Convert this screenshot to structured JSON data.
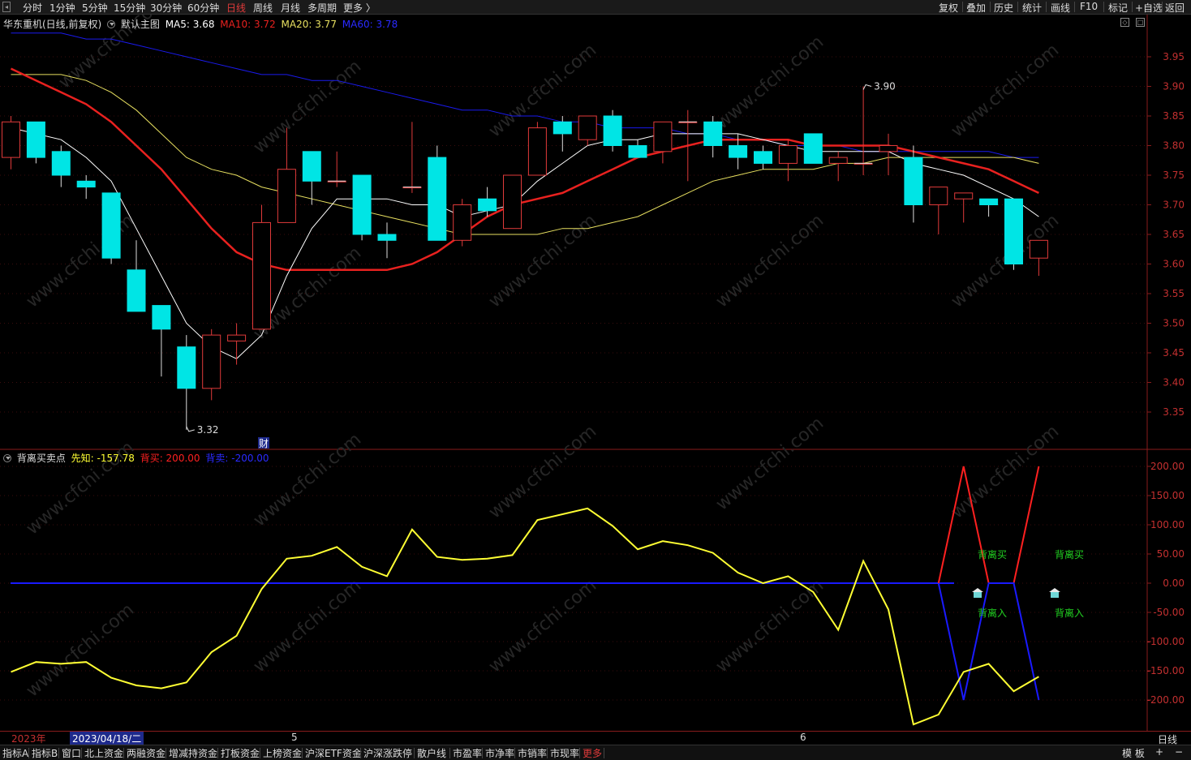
{
  "toolbar": {
    "periods": [
      "分时",
      "1分钟",
      "5分钟",
      "15分钟",
      "30分钟",
      "60分钟",
      "日线",
      "周线",
      "月线",
      "多周期",
      "更多 〉"
    ],
    "active_period": "日线",
    "right_buttons": [
      "复权",
      "叠加",
      "历史",
      "统计",
      "画线",
      "F10",
      "标记",
      "+自选",
      "返回"
    ]
  },
  "main_legend": {
    "stock": "华东重机(日线,前复权)",
    "template": "默认主图",
    "ma5": "MA5: 3.68",
    "ma10": "MA10: 3.72",
    "ma20": "MA20: 3.77",
    "ma60": "MA60: 3.78"
  },
  "sub_legend": {
    "name": "背离买卖点",
    "xianzhi": "先知: -157.78",
    "beimai": "背买: 200.00",
    "beimai_sell": "背卖: -200.00"
  },
  "annotations": {
    "high": "3.90",
    "low": "3.32",
    "finance_badge": "财",
    "buy1": "背离买",
    "buy2": "背离买",
    "in1": "背离入",
    "in2": "背离入"
  },
  "date_axis": {
    "year": "2023年",
    "selected_date": "2023/04/18/二",
    "month5": "5",
    "month6": "6",
    "period_label": "日线"
  },
  "bottom_tabs": [
    "指标A",
    "指标B",
    "窗口",
    "北上资金",
    "两融资金",
    "增减持资金",
    "打板资金",
    "上榜资金",
    "沪深ETF资金",
    "沪深涨跌停",
    "散户线",
    "市盈率",
    "市净率",
    "市销率",
    "市现率",
    "更多"
  ],
  "bottom_right": [
    "模 板",
    "+",
    "−"
  ],
  "watermark": "www.cfchi.com",
  "colors": {
    "up": "#e03a3a",
    "down": "#00e5e5",
    "ma5": "#ffffff",
    "ma10": "#e8211f",
    "ma20": "#e8e060",
    "ma60": "#1a1aee",
    "xianzhi": "#ffff33",
    "beimai": "#ff2020",
    "beimai_sell": "#1a1aff",
    "signal_text": "#21d021"
  },
  "chart_data": [
    {
      "type": "candlestick",
      "title": "华东重机(日线,前复权)",
      "ylim": [
        3.29,
        3.99
      ],
      "yticks": [
        "3.95",
        "3.90",
        "3.85",
        "3.80",
        "3.75",
        "3.70",
        "3.65",
        "3.60",
        "3.55",
        "3.50",
        "3.45",
        "3.40",
        "3.35"
      ],
      "candles": [
        {
          "o": 3.78,
          "h": 3.85,
          "l": 3.76,
          "c": 3.84
        },
        {
          "o": 3.84,
          "h": 3.84,
          "l": 3.77,
          "c": 3.78
        },
        {
          "o": 3.79,
          "h": 3.8,
          "l": 3.73,
          "c": 3.75
        },
        {
          "o": 3.74,
          "h": 3.75,
          "l": 3.71,
          "c": 3.73
        },
        {
          "o": 3.72,
          "h": 3.72,
          "l": 3.6,
          "c": 3.61
        },
        {
          "o": 3.59,
          "h": 3.64,
          "l": 3.52,
          "c": 3.52
        },
        {
          "o": 3.53,
          "h": 3.53,
          "l": 3.41,
          "c": 3.49
        },
        {
          "o": 3.46,
          "h": 3.48,
          "l": 3.32,
          "c": 3.39
        },
        {
          "o": 3.39,
          "h": 3.49,
          "l": 3.37,
          "c": 3.48
        },
        {
          "o": 3.47,
          "h": 3.5,
          "l": 3.43,
          "c": 3.48
        },
        {
          "o": 3.49,
          "h": 3.7,
          "l": 3.49,
          "c": 3.67
        },
        {
          "o": 3.67,
          "h": 3.83,
          "l": 3.67,
          "c": 3.76
        },
        {
          "o": 3.79,
          "h": 3.79,
          "l": 3.7,
          "c": 3.74
        },
        {
          "o": 3.74,
          "h": 3.79,
          "l": 3.73,
          "c": 3.74
        },
        {
          "o": 3.75,
          "h": 3.75,
          "l": 3.64,
          "c": 3.65
        },
        {
          "o": 3.65,
          "h": 3.67,
          "l": 3.61,
          "c": 3.64
        },
        {
          "o": 3.73,
          "h": 3.84,
          "l": 3.72,
          "c": 3.73
        },
        {
          "o": 3.78,
          "h": 3.8,
          "l": 3.64,
          "c": 3.64
        },
        {
          "o": 3.64,
          "h": 3.71,
          "l": 3.63,
          "c": 3.7
        },
        {
          "o": 3.71,
          "h": 3.73,
          "l": 3.68,
          "c": 3.69
        },
        {
          "o": 3.66,
          "h": 3.75,
          "l": 3.66,
          "c": 3.75
        },
        {
          "o": 3.75,
          "h": 3.84,
          "l": 3.75,
          "c": 3.83
        },
        {
          "o": 3.84,
          "h": 3.85,
          "l": 3.79,
          "c": 3.82
        },
        {
          "o": 3.81,
          "h": 3.85,
          "l": 3.8,
          "c": 3.85
        },
        {
          "o": 3.85,
          "h": 3.86,
          "l": 3.79,
          "c": 3.8
        },
        {
          "o": 3.8,
          "h": 3.81,
          "l": 3.78,
          "c": 3.78
        },
        {
          "o": 3.79,
          "h": 3.84,
          "l": 3.77,
          "c": 3.84
        },
        {
          "o": 3.84,
          "h": 3.86,
          "l": 3.74,
          "c": 3.84
        },
        {
          "o": 3.84,
          "h": 3.85,
          "l": 3.78,
          "c": 3.8
        },
        {
          "o": 3.8,
          "h": 3.82,
          "l": 3.76,
          "c": 3.78
        },
        {
          "o": 3.79,
          "h": 3.8,
          "l": 3.76,
          "c": 3.77
        },
        {
          "o": 3.77,
          "h": 3.81,
          "l": 3.74,
          "c": 3.8
        },
        {
          "o": 3.82,
          "h": 3.82,
          "l": 3.77,
          "c": 3.77
        },
        {
          "o": 3.77,
          "h": 3.79,
          "l": 3.74,
          "c": 3.78
        },
        {
          "o": 3.77,
          "h": 3.9,
          "l": 3.75,
          "c": 3.77
        },
        {
          "o": 3.79,
          "h": 3.82,
          "l": 3.75,
          "c": 3.8
        },
        {
          "o": 3.78,
          "h": 3.8,
          "l": 3.67,
          "c": 3.7
        },
        {
          "o": 3.7,
          "h": 3.73,
          "l": 3.65,
          "c": 3.73
        },
        {
          "o": 3.71,
          "h": 3.72,
          "l": 3.67,
          "c": 3.72
        },
        {
          "o": 3.71,
          "h": 3.71,
          "l": 3.68,
          "c": 3.7
        },
        {
          "o": 3.71,
          "h": 3.71,
          "l": 3.59,
          "c": 3.6
        },
        {
          "o": 3.61,
          "h": 3.64,
          "l": 3.58,
          "c": 3.64
        }
      ],
      "ma5": [
        3.83,
        3.82,
        3.81,
        3.78,
        3.74,
        3.66,
        3.58,
        3.5,
        3.46,
        3.44,
        3.48,
        3.58,
        3.66,
        3.71,
        3.71,
        3.71,
        3.7,
        3.7,
        3.68,
        3.69,
        3.7,
        3.74,
        3.77,
        3.8,
        3.81,
        3.81,
        3.82,
        3.82,
        3.82,
        3.82,
        3.81,
        3.8,
        3.79,
        3.79,
        3.79,
        3.79,
        3.77,
        3.76,
        3.75,
        3.73,
        3.71,
        3.68
      ],
      "ma10": [
        3.93,
        3.91,
        3.89,
        3.87,
        3.84,
        3.8,
        3.76,
        3.71,
        3.66,
        3.62,
        3.6,
        3.59,
        3.59,
        3.59,
        3.59,
        3.59,
        3.6,
        3.62,
        3.65,
        3.68,
        3.7,
        3.71,
        3.72,
        3.74,
        3.76,
        3.78,
        3.79,
        3.8,
        3.81,
        3.81,
        3.81,
        3.81,
        3.8,
        3.8,
        3.8,
        3.8,
        3.79,
        3.78,
        3.77,
        3.76,
        3.74,
        3.72
      ],
      "ma20": [
        3.92,
        3.92,
        3.92,
        3.91,
        3.89,
        3.86,
        3.82,
        3.78,
        3.76,
        3.75,
        3.73,
        3.72,
        3.71,
        3.7,
        3.69,
        3.68,
        3.67,
        3.66,
        3.65,
        3.65,
        3.65,
        3.65,
        3.66,
        3.66,
        3.67,
        3.68,
        3.7,
        3.72,
        3.74,
        3.75,
        3.76,
        3.76,
        3.76,
        3.77,
        3.77,
        3.78,
        3.78,
        3.78,
        3.78,
        3.78,
        3.78,
        3.77
      ],
      "ma60": [
        3.99,
        3.99,
        3.99,
        3.98,
        3.98,
        3.97,
        3.96,
        3.95,
        3.94,
        3.93,
        3.92,
        3.92,
        3.91,
        3.91,
        3.9,
        3.89,
        3.88,
        3.87,
        3.86,
        3.86,
        3.85,
        3.85,
        3.84,
        3.84,
        3.83,
        3.83,
        3.83,
        3.82,
        3.82,
        3.81,
        3.81,
        3.8,
        3.8,
        3.8,
        3.79,
        3.79,
        3.79,
        3.79,
        3.79,
        3.79,
        3.78,
        3.78
      ]
    },
    {
      "type": "line",
      "title": "背离买卖点",
      "ylim": [
        -250,
        225
      ],
      "yticks": [
        "200.00",
        "150.00",
        "100.00",
        "50.00",
        "0.00",
        "-50.00",
        "-100.00",
        "-150.00",
        "-200.00"
      ],
      "series": [
        {
          "name": "先知",
          "values": [
            -152,
            -135,
            -138,
            -135,
            -162,
            -175,
            -180,
            -170,
            -118,
            -90,
            -10,
            42,
            47,
            62,
            28,
            12,
            92,
            45,
            40,
            42,
            48,
            108,
            118,
            128,
            98,
            58,
            72,
            65,
            52,
            18,
            0,
            12,
            -15,
            -80,
            38,
            -45,
            -242,
            -225,
            -152,
            -138,
            -185,
            -160
          ]
        },
        {
          "name": "背买",
          "values": [
            0,
            0,
            0,
            0,
            0,
            0,
            0,
            0,
            0,
            0,
            0,
            0,
            0,
            0,
            0,
            0,
            0,
            0,
            0,
            0,
            0,
            0,
            0,
            0,
            0,
            0,
            0,
            0,
            0,
            0,
            0,
            0,
            0,
            0,
            0,
            0,
            0,
            0,
            200,
            0,
            0,
            200
          ]
        },
        {
          "name": "背卖",
          "values": [
            0,
            0,
            0,
            0,
            0,
            0,
            0,
            0,
            0,
            0,
            0,
            0,
            0,
            0,
            0,
            0,
            0,
            0,
            0,
            0,
            0,
            0,
            0,
            0,
            0,
            0,
            0,
            0,
            0,
            0,
            0,
            0,
            0,
            0,
            0,
            0,
            0,
            0,
            -200,
            0,
            0,
            -200
          ]
        }
      ]
    }
  ]
}
